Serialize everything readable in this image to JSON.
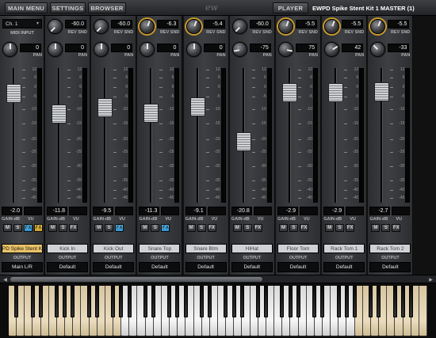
{
  "topbar": {
    "main_menu": "MAIN MENU",
    "settings": "SETTINGS",
    "browser": "BROWSER",
    "logo": "ew",
    "player": "PLAYER",
    "master_title": "EWPD Spike Stent Kit 1 MASTER (1)"
  },
  "labels": {
    "rev_snd": "REV SND",
    "pan": "PAN",
    "gain": "GAIN-dB",
    "vu": "VU",
    "output": "OUTPUT",
    "midi_input": "MIDI INPUT",
    "mute": "M",
    "solo": "S",
    "fx": "FX"
  },
  "midi": {
    "channel": "Ch. 1"
  },
  "scale_values": [
    "12",
    "6",
    "0",
    "-5",
    "-10",
    "-15",
    "-20",
    "-25",
    "-30",
    "-35",
    "-40",
    "-45"
  ],
  "first_strip": {
    "pan": "0",
    "gain": "-2.0",
    "name": "EWPD Spike Stent Kit ...",
    "output": "Main L/R"
  },
  "channels": [
    {
      "rev_snd": "-60.0",
      "pan": "0",
      "gain": "-11.8",
      "name": "Kick In",
      "output": "Default",
      "fx_active": false,
      "gold": false
    },
    {
      "rev_snd": "-60.0",
      "pan": "0",
      "gain": "-9.5",
      "name": "Kick Out",
      "output": "Default",
      "fx_active": true,
      "gold": false
    },
    {
      "rev_snd": "-6.3",
      "pan": "0",
      "gain": "-11.3",
      "name": "Snare Top",
      "output": "Default",
      "fx_active": true,
      "gold": true
    },
    {
      "rev_snd": "-5.4",
      "pan": "0",
      "gain": "-9.1",
      "name": "Snare Btm",
      "output": "Default",
      "fx_active": false,
      "gold": true
    },
    {
      "rev_snd": "-60.0",
      "pan": "-75",
      "gain": "-20.8",
      "name": "HiHat",
      "output": "Default",
      "fx_active": false,
      "gold": false
    },
    {
      "rev_snd": "-5.5",
      "pan": "75",
      "gain": "-2.9",
      "name": "Floor Tom",
      "output": "Default",
      "fx_active": false,
      "gold": true
    },
    {
      "rev_snd": "-5.5",
      "pan": "42",
      "gain": "-2.9",
      "name": "Rack Tom 1",
      "output": "Default",
      "fx_active": false,
      "gold": true
    },
    {
      "rev_snd": "-5.5",
      "pan": "-33",
      "gain": "-2.7",
      "name": "Rack Tom 2",
      "output": "Default",
      "fx_active": false,
      "gold": true
    }
  ],
  "colors": {
    "accent_gold": "#c99b2a",
    "fx_blue": "#3a9fd9",
    "key_tint": "#e5d4b0"
  },
  "icons": {
    "scroll_left": "◀",
    "scroll_right": "▶",
    "dropdown": "▾"
  }
}
